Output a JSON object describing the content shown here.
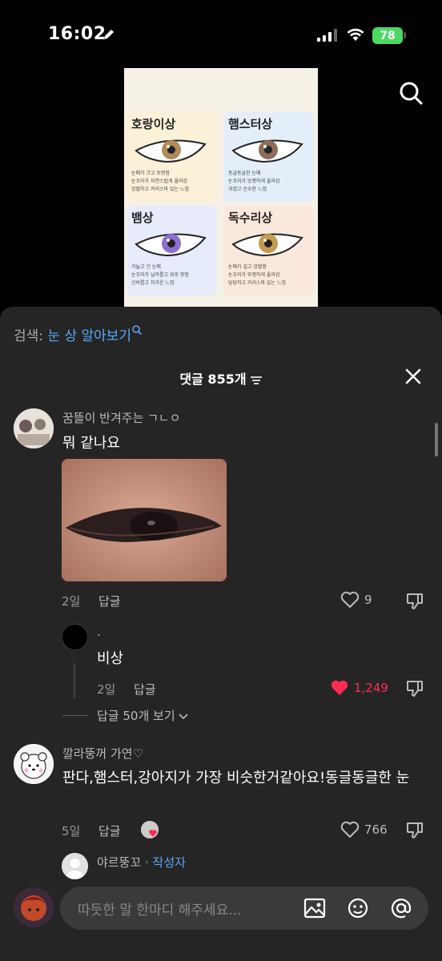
{
  "status_bar": {
    "time": "16:02",
    "battery": "78"
  },
  "search": {
    "prefix": "검색: ",
    "query": "눈 상 알아보기"
  },
  "header": {
    "title": "댓글 855개"
  },
  "video_cards": [
    {
      "title": "호랑이상",
      "lines": [
        "눈매가 크고 또렷함",
        "눈꼬리가 자연스럽게 올라감",
        "강렬하고 카리스마 있는 느낌"
      ],
      "bg": "#fbf0d8",
      "iris": "#b08a5a"
    },
    {
      "title": "햄스터상",
      "lines": [
        "동글동글한 눈매",
        "눈꼬리가 또렷하게 올라감",
        "귀엽고 순수한 느낌"
      ],
      "bg": "#e3eef8",
      "iris": "#8c6d5a"
    },
    {
      "title": "뱀상",
      "lines": [
        "가늘고 긴 눈매",
        "눈꼬리가 날카롭고 위로 향함",
        "신비롭고 차가운 느낌"
      ],
      "bg": "#e6ecfa",
      "iris": "#8a6fd0"
    },
    {
      "title": "독수리상",
      "lines": [
        "눈매가 길고 강렬함",
        "눈꼬리가 뚜렷하게 올라감",
        "당당하고 카리스마 있는 느낌"
      ],
      "bg": "#fbe8dc",
      "iris": "#c49a50"
    }
  ],
  "comments": [
    {
      "username": "꿈뜰이 반겨주는 ㄱㄴㅇ",
      "text": "뭐 같나요",
      "age": "2일",
      "reply_label": "답글",
      "likes": "9"
    },
    {
      "username": ".",
      "text": "비상",
      "age": "2일",
      "reply_label": "답글",
      "likes": "1,249"
    },
    {
      "username": "깔라뚱꺼 가연♡",
      "text": "판다,햄스터,강아지가 가장 비슷한거같아요!동글동글한 눈",
      "age": "5일",
      "reply_label": "답글",
      "likes": "766"
    }
  ],
  "more_replies": "답글 50개 보기",
  "next_reply": {
    "username": "야르뚱꼬",
    "badge": "작성자"
  },
  "input": {
    "placeholder": "따듯한 말 한마디 해주세요..."
  },
  "colors": {
    "accent_blue": "#5aa8ff",
    "like_red": "#fe2c55",
    "sheet_bg": "#252525"
  }
}
